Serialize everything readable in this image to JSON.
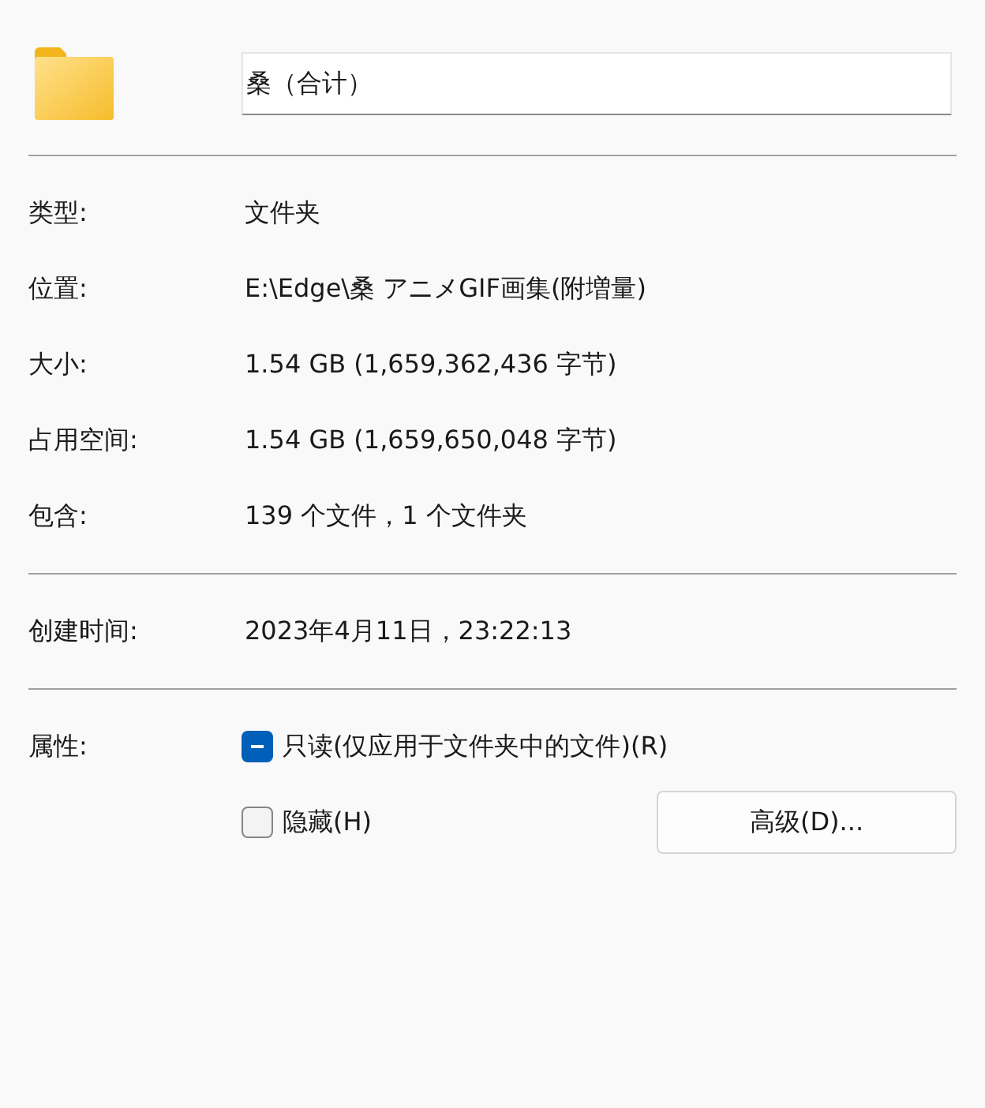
{
  "name_field": {
    "value": "桑（合计）"
  },
  "sections": [
    [
      {
        "label": "类型:",
        "value": "文件夹"
      },
      {
        "label": "位置:",
        "value": "E:\\Edge\\桑 アニメGIF画集(附増量)"
      },
      {
        "label": "大小:",
        "value": "1.54 GB (1,659,362,436 字节)"
      },
      {
        "label": "占用空间:",
        "value": "1.54 GB (1,659,650,048 字节)"
      },
      {
        "label": "包含:",
        "value": "139 个文件，1 个文件夹"
      }
    ],
    [
      {
        "label": "创建时间:",
        "value": "2023年4月11日，23:22:13"
      }
    ]
  ],
  "attributes": {
    "label": "属性:",
    "checkboxes": [
      {
        "label": "只读(仅应用于文件夹中的文件)(R)",
        "checked": false,
        "indeterminate": true
      },
      {
        "label": "隐藏(H)",
        "checked": false,
        "indeterminate": false
      }
    ],
    "advanced_button": "高级(D)..."
  }
}
